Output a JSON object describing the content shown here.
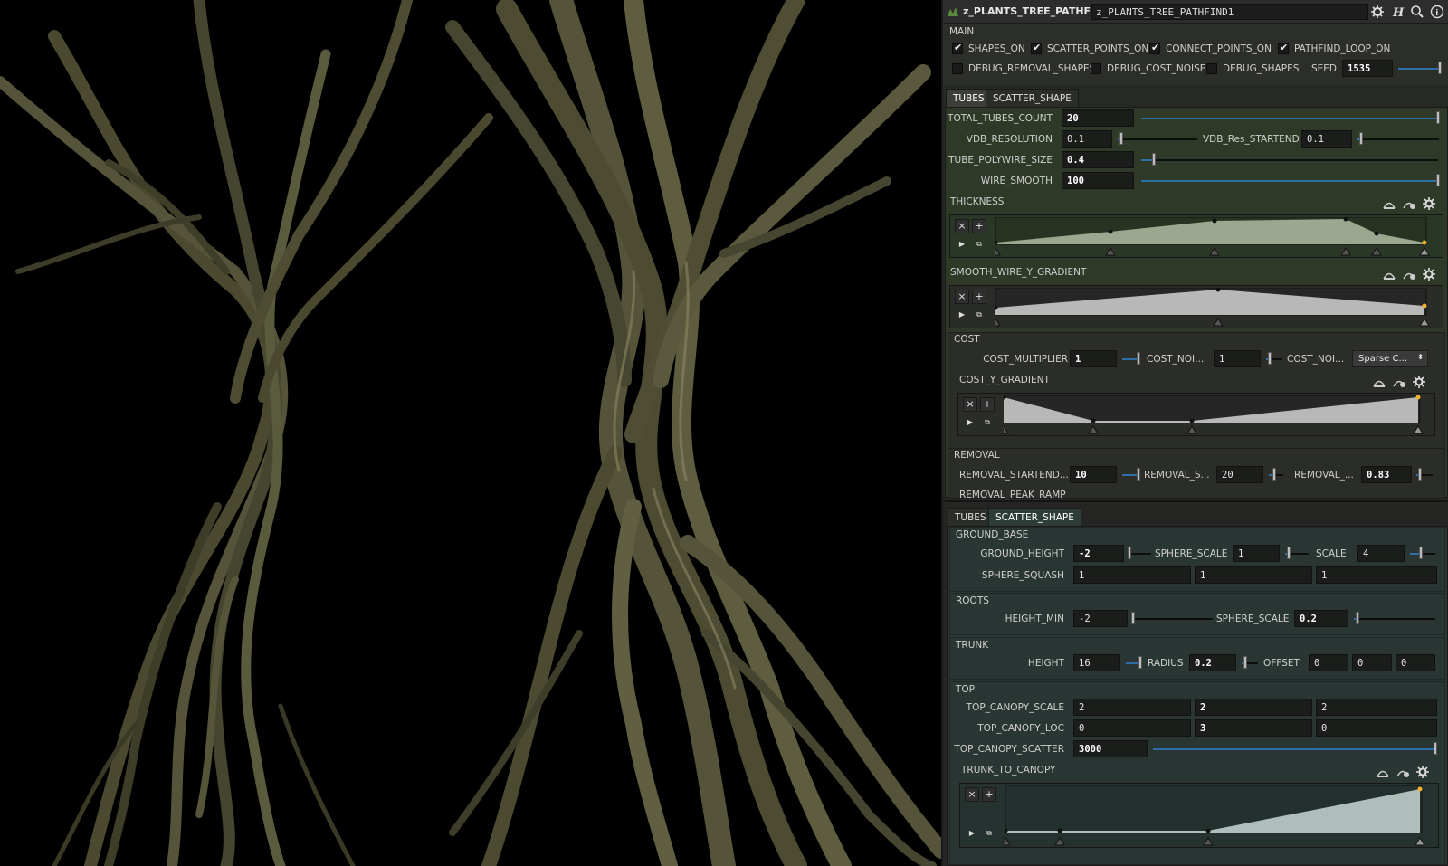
{
  "header": {
    "node_type": "z_PLANTS_TREE_PATHFIND",
    "node_name": "z_PLANTS_TREE_PATHFIND1",
    "icons": [
      "gear-icon",
      "help-h-icon",
      "search-icon",
      "info-icon"
    ]
  },
  "main": {
    "section_label": "MAIN",
    "toggles": [
      {
        "label": "SHAPES_ON",
        "checked": true
      },
      {
        "label": "SCATTER_POINTS_ON",
        "checked": true
      },
      {
        "label": "CONNECT_POINTS_ON",
        "checked": true
      },
      {
        "label": "PATHFIND_LOOP_ON",
        "checked": true
      },
      {
        "label": "DEBUG_REMOVAL_SHAPES",
        "checked": false
      },
      {
        "label": "DEBUG_COST_NOISE",
        "checked": false
      },
      {
        "label": "DEBUG_SHAPES",
        "checked": false
      }
    ],
    "seed_label": "SEED",
    "seed_value": "1535"
  },
  "tabs_top": [
    "TUBES",
    "SCATTER_SHAPE"
  ],
  "tubes": {
    "total_tubes_label": "TOTAL_TUBES_COUNT",
    "total_tubes_value": "20",
    "vdb_res_label": "VDB_RESOLUTION",
    "vdb_res_value": "0.1",
    "vdb_startend_label": "VDB_Res_STARTEND",
    "vdb_startend_value": "0.1",
    "polywire_label": "TUBE_POLYWIRE_SIZE",
    "polywire_value": "0.4",
    "wire_smooth_label": "WIRE_SMOOTH",
    "wire_smooth_value": "100",
    "thickness_label": "THICKNESS",
    "smooth_wire_label": "SMOOTH_WIRE_Y_GRADIENT",
    "cost_section": "COST",
    "cost_mult_label": "COST_MULTIPLIER",
    "cost_mult_value": "1",
    "cost_noi_label": "COST_NOI...",
    "cost_noi_value": "1",
    "cost_noi2_label": "COST_NOI...",
    "cost_noi2_value": "Sparse C...",
    "cost_y_label": "COST_Y_GRADIENT",
    "removal_section": "REMOVAL",
    "removal_startend_label": "REMOVAL_STARTEND...",
    "removal_startend_value": "10",
    "removal_s_label": "REMOVAL_S...",
    "removal_s_value": "20",
    "removal_3_label": "REMOVAL_...",
    "removal_3_value": "0.83",
    "removal_peak_label": "REMOVAL_PEAK_RAMP"
  },
  "tabs_bottom": [
    "TUBES",
    "SCATTER_SHAPE"
  ],
  "scatter": {
    "ground_section": "GROUND_BASE",
    "ground_height_label": "GROUND_HEIGHT",
    "ground_height_value": "-2",
    "sphere_scale_label": "SPHERE_SCALE",
    "sphere_scale_value": "1",
    "scale_label": "SCALE",
    "scale_value": "4",
    "sphere_squash_label": "SPHERE_SQUASH",
    "sphere_squash_values": [
      "1",
      "1",
      "1"
    ],
    "roots_section": "ROOTS",
    "height_min_label": "HEIGHT_MIN",
    "height_min_value": "-2",
    "roots_sphere_scale_label": "SPHERE_SCALE",
    "roots_sphere_scale_value": "0.2",
    "trunk_section": "TRUNK",
    "height_label": "HEIGHT",
    "height_value": "16",
    "radius_label": "RADIUS",
    "radius_value": "0.2",
    "offset_label": "OFFSET",
    "offset_values": [
      "0",
      "0",
      "0"
    ],
    "top_section": "TOP",
    "canopy_scale_label": "TOP_CANOPY_SCALE",
    "canopy_scale_values": [
      "2",
      "2",
      "2"
    ],
    "canopy_loc_label": "TOP_CANOPY_LOC",
    "canopy_loc_values": [
      "0",
      "3",
      "0"
    ],
    "canopy_scatter_label": "TOP_CANOPY_SCATTER",
    "canopy_scatter_value": "3000",
    "trunk_to_canopy_label": "TRUNK_TO_CANOPY"
  },
  "colors": {
    "panel_top": "#2e3a27",
    "panel_bottom": "#2a3633",
    "slider_fill": "#2f6fa8",
    "tree_bark": "#4a4a30"
  }
}
